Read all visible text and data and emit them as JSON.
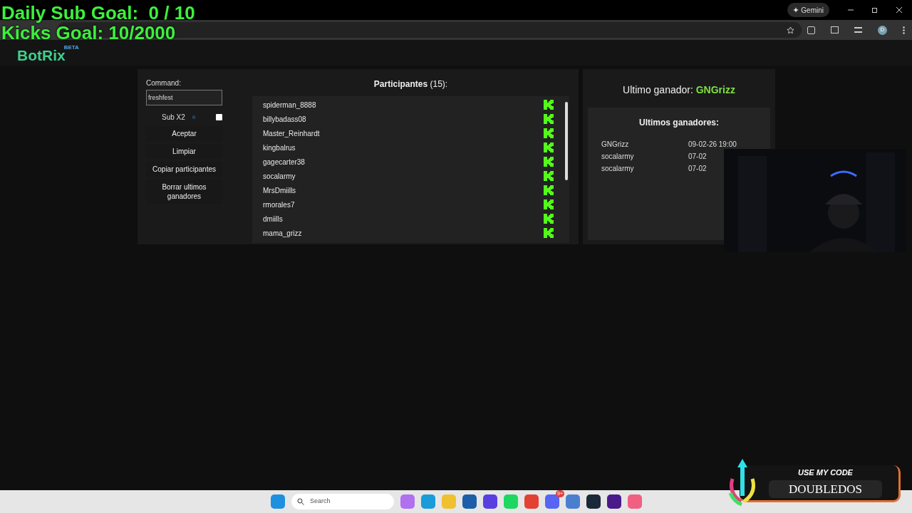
{
  "overlay": {
    "goals": [
      "Daily Sub Goal:  0 / 10",
      "Kicks Goal: 10/2000"
    ],
    "promo": {
      "caption": "USE MY CODE",
      "code": "DOUBLEDOS"
    },
    "webcam": {
      "kind": "picture"
    }
  },
  "browser": {
    "gemini": "Gemini",
    "avatar": "D"
  },
  "header": {
    "logo": "BotRix",
    "badge": "BETA"
  },
  "controls": {
    "command_label": "Command:",
    "command_value": "freshfest",
    "sub_x2": {
      "label": "Sub X2",
      "checked": false
    },
    "buttons": [
      "Aceptar",
      "Limpiar",
      "Copiar participantes",
      "Borrar ultimos ganadores"
    ]
  },
  "participants": {
    "title": "Participantes",
    "count": "(15):",
    "items": [
      "spiderman_8888",
      "billybadass08",
      "Master_Reinhardt",
      "kingbalrus",
      "gagecarter38",
      "socalarmy",
      "MrsDmiills",
      "rmorales7",
      "dmiills",
      "mama_grizz"
    ]
  },
  "winner": {
    "label": "Ultimo ganador:",
    "name": "GNGrizz"
  },
  "last_winners": {
    "title": "Ultimos ganadores:",
    "rows": [
      {
        "name": "GNGrizz",
        "date": "09-02-26 19:00"
      },
      {
        "name": "socalarmy",
        "date": "07-02"
      },
      {
        "name": "socalarmy",
        "date": "07-02"
      }
    ]
  },
  "taskbar": {
    "search": "Search",
    "discord_badge": "9+"
  }
}
